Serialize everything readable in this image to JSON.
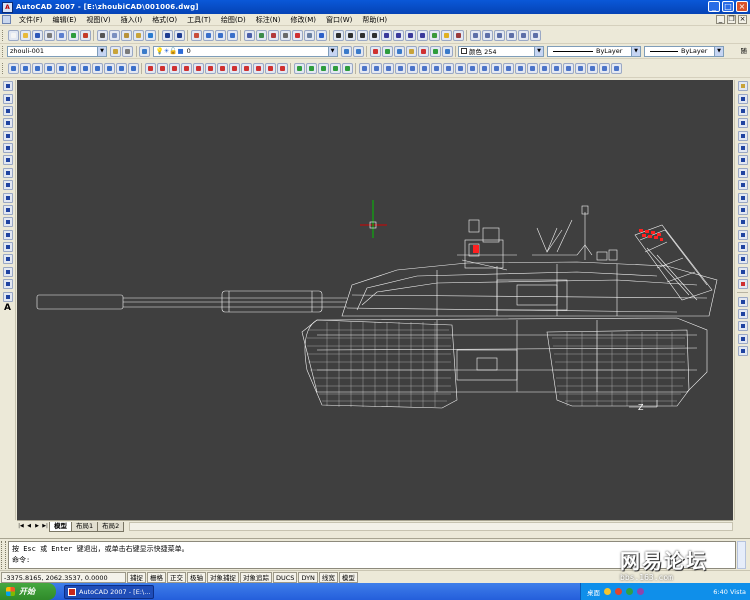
{
  "window": {
    "title": "AutoCAD 2007 - [E:\\zhoubiCAD\\001006.dwg]",
    "app_icon_label": "A",
    "minimize": "_",
    "maximize": "□",
    "close": "×"
  },
  "menu": {
    "items": [
      "文件(F)",
      "编辑(E)",
      "视图(V)",
      "插入(I)",
      "格式(O)",
      "工具(T)",
      "绘图(D)",
      "标注(N)",
      "修改(M)",
      "窗口(W)",
      "帮助(H)"
    ],
    "doc_minimize": "_",
    "doc_restore": "❐",
    "doc_close": "×"
  },
  "toolbar2": {
    "layer_value": "zhouli-001",
    "layer_state": "0",
    "color_value": "颜色 254",
    "linetype_value": "ByLayer",
    "lineweight_value": "ByLayer",
    "side_label": "随"
  },
  "tabs": {
    "nav": [
      "|◀",
      "◀",
      "▶",
      "▶|"
    ],
    "items": [
      "模型",
      "布局1",
      "布局2"
    ]
  },
  "command": {
    "line1": "按 Esc 或 Enter 键退出，或单击右键显示快捷菜单。",
    "line2": "命令:"
  },
  "status": {
    "coords": "-3375.8165, 2062.3537, 0.0000",
    "buttons": [
      "捕捉",
      "栅格",
      "正交",
      "极轴",
      "对象捕捉",
      "对象追踪",
      "DUCS",
      "DYN",
      "线宽",
      "模型"
    ]
  },
  "watermark": {
    "brand": "网易论坛",
    "url": "bbs.163.com"
  },
  "taskbar": {
    "start_label": "开始",
    "task1": "AutoCAD 2007 - [E:\\...",
    "task2": "",
    "tray_label": "桌面",
    "clock": "6:40 Vista"
  },
  "colors": {
    "canvas": "#3F3F3F",
    "wireframe": "#FFFFFF",
    "crosshair_x": "#D00000",
    "crosshair_y": "#00C000",
    "highlight": "#FF2020"
  }
}
